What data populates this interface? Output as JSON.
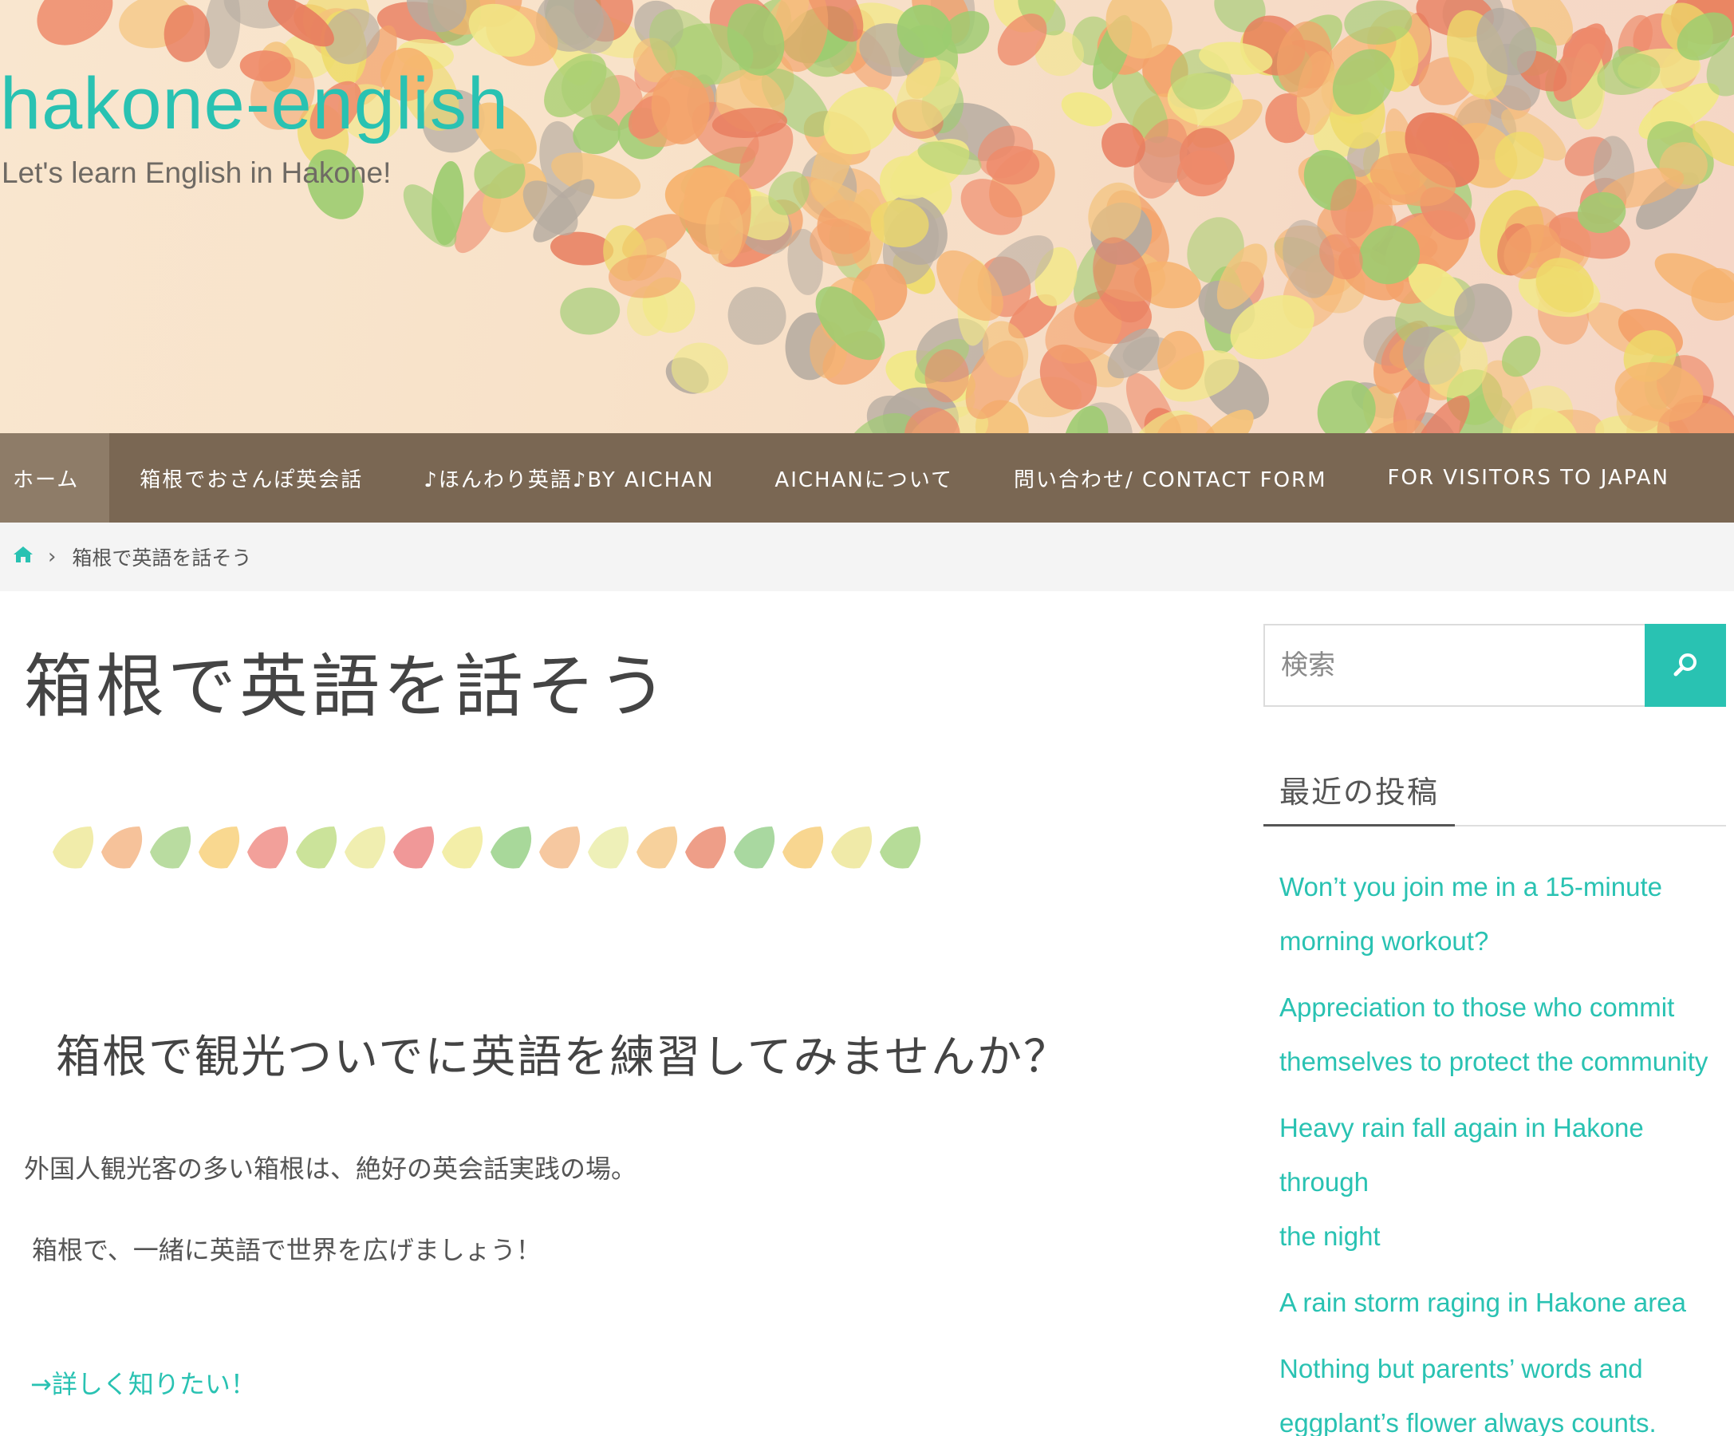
{
  "site": {
    "title": "hakone-english",
    "description": "Let's learn English in Hakone!"
  },
  "nav": {
    "items": [
      {
        "label": "ホーム"
      },
      {
        "label": "箱根でおさんぽ英会話"
      },
      {
        "label": "♪ほんわり英語♪BY AICHAN"
      },
      {
        "label": "AICHANについて"
      },
      {
        "label": "問い合わせ/ CONTACT FORM"
      },
      {
        "label": "FOR VISITORS TO JAPAN"
      }
    ]
  },
  "breadcrumb": {
    "home_icon": "home-icon",
    "separator": "›",
    "current": "箱根で英語を話そう"
  },
  "main": {
    "title": "箱根で英語を話そう",
    "subheading": "箱根で観光ついでに英語を練習してみませんか？",
    "paragraph1": "外国人観光客の多い箱根は、絶好の英会話実践の場。",
    "paragraph2": "箱根で、一緒に英語で世界を広げましょう！",
    "link": "→詳しく知りたい！"
  },
  "sidebar": {
    "search": {
      "placeholder": "検索",
      "button_icon": "search-icon"
    },
    "recent_title": "最近の投稿",
    "recent_posts": [
      {
        "line1": "Won’t you join me in a 15-minute",
        "line2": "morning workout?"
      },
      {
        "line1": "Appreciation to those who commit",
        "line2": "themselves to protect the community"
      },
      {
        "line1": "Heavy rain fall again in Hakone through",
        "line2": "the night"
      },
      {
        "line1": "A rain storm raging in Hakone area",
        "line2": ""
      },
      {
        "line1": "Nothing but parents’ words and",
        "line2": "eggplant’s flower always counts."
      }
    ]
  },
  "colors": {
    "accent": "#29c2b2",
    "nav_bg": "#7a6753",
    "nav_active_bg": "#8e7c68",
    "breadcrumb_bg": "#f4f4f4"
  }
}
